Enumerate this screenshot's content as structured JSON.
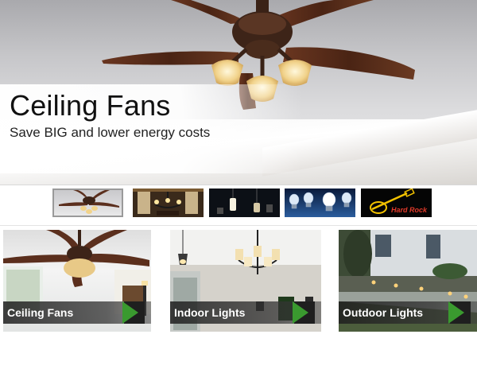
{
  "hero": {
    "title": "Ceiling Fans",
    "subtitle": "Save BIG and lower energy costs"
  },
  "thumbnails": [
    {
      "subject": "ceiling-fan",
      "selected": true
    },
    {
      "subject": "chandelier-dining",
      "selected": false
    },
    {
      "subject": "pendant-lights",
      "selected": false
    },
    {
      "subject": "light-bulbs",
      "selected": false
    },
    {
      "subject": "hard-rock-neon-sign",
      "selected": false,
      "logo_text": "Hard Rock"
    }
  ],
  "categories": [
    {
      "label": "Ceiling Fans"
    },
    {
      "label": "Indoor Lights"
    },
    {
      "label": "Outdoor Lights"
    }
  ],
  "colors": {
    "arrow_green": "#3a9a2f",
    "label_bar": "#2a2a2a",
    "fan_blade": "#5b2f1d",
    "fan_glass": "#f2d38a"
  }
}
